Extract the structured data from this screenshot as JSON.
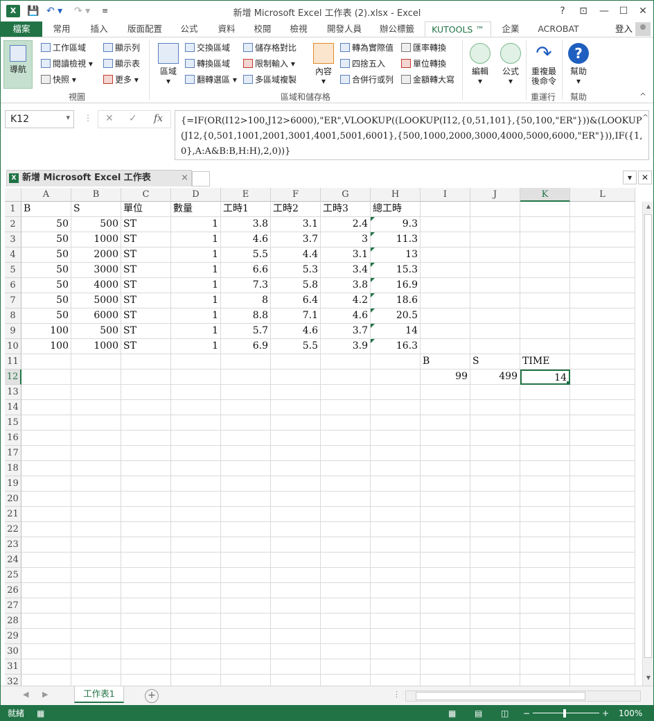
{
  "titlebar": {
    "title": "新增 Microsoft Excel 工作表 (2).xlsx - Excel",
    "help": "?",
    "restore": "⊡",
    "minimize": "—",
    "maximize": "☐",
    "close": "✕"
  },
  "tabs": {
    "file": "檔案",
    "home": "常用",
    "insert": "插入",
    "layout": "版面配置",
    "formulas": "公式",
    "data": "資料",
    "review": "校閱",
    "view": "檢視",
    "developer": "開發人員",
    "office": "辦公標籤",
    "kutools": "KUTOOLS ™",
    "enterprise": "企業",
    "acrobat": "ACROBAT",
    "login": "登入"
  },
  "ribbon": {
    "nav": "導航",
    "workarea": "工作區域",
    "readview": "閱讀檢視",
    "snapshot": "快照",
    "showcol": "顯示列",
    "showsheet": "顯示表",
    "more": "更多",
    "view_group": "視圖",
    "range": "區域",
    "swap": "交換區域",
    "transform": "轉換區域",
    "flip": "翻轉選區",
    "compare": "儲存格對比",
    "limit": "限制輸入",
    "multicopy": "多區域複製",
    "content": "內容",
    "toactual": "轉為實際值",
    "round": "四捨五入",
    "merge": "合併行或列",
    "currency": "匯率轉換",
    "unit": "單位轉換",
    "upper": "金額轉大寫",
    "range_group": "區域和儲存格",
    "edit": "編輯",
    "formula": "公式",
    "rerun": "重複最\n後命令",
    "rerun_group": "重運行",
    "help": "幫助",
    "help_group": "幫助"
  },
  "formulabar": {
    "namebox": "K12",
    "fx": "fx",
    "formula": "{=IF(OR(I12>100,J12>6000),\"ER\",VLOOKUP((LOOKUP(I12,{0,51,101},{50,100,\"ER\"}))&(LOOKUP(J12,{0,501,1001,2001,3001,4001,5001,6001},{500,1000,2000,3000,4000,5000,6000,\"ER\"})),IF({1,0},A:A&B:B,H:H),2,0))}"
  },
  "workbook": {
    "tab": "新增 Microsoft Excel 工作表 (2).xlsx *"
  },
  "sheet": {
    "columns": [
      "A",
      "B",
      "C",
      "D",
      "E",
      "F",
      "G",
      "H",
      "I",
      "J",
      "K",
      "L"
    ],
    "rows": [
      "1",
      "2",
      "3",
      "4",
      "5",
      "6",
      "7",
      "8",
      "9",
      "10",
      "11",
      "12",
      "13",
      "14",
      "15",
      "16",
      "17",
      "18",
      "19",
      "20",
      "21",
      "22",
      "23",
      "24",
      "25",
      "26",
      "27",
      "28",
      "29",
      "30",
      "31",
      "32"
    ],
    "header": [
      "B",
      "S",
      "單位",
      "數量",
      "工時1",
      "工時2",
      "工時3",
      "總工時"
    ],
    "data": [
      [
        "50",
        "500",
        "ST",
        "1",
        "3.8",
        "3.1",
        "2.4",
        "9.3"
      ],
      [
        "50",
        "1000",
        "ST",
        "1",
        "4.6",
        "3.7",
        "3",
        "11.3"
      ],
      [
        "50",
        "2000",
        "ST",
        "1",
        "5.5",
        "4.4",
        "3.1",
        "13"
      ],
      [
        "50",
        "3000",
        "ST",
        "1",
        "6.6",
        "5.3",
        "3.4",
        "15.3"
      ],
      [
        "50",
        "4000",
        "ST",
        "1",
        "7.3",
        "5.8",
        "3.8",
        "16.9"
      ],
      [
        "50",
        "5000",
        "ST",
        "1",
        "8",
        "6.4",
        "4.2",
        "18.6"
      ],
      [
        "50",
        "6000",
        "ST",
        "1",
        "8.8",
        "7.1",
        "4.6",
        "20.5"
      ],
      [
        "100",
        "500",
        "ST",
        "1",
        "5.7",
        "4.6",
        "3.7",
        "14"
      ],
      [
        "100",
        "1000",
        "ST",
        "1",
        "6.9",
        "5.5",
        "3.9",
        "16.3"
      ]
    ],
    "lookup_headers": [
      "B",
      "S",
      "TIME"
    ],
    "lookup_values": [
      "99",
      "499",
      "14"
    ],
    "active_cell": "K12",
    "name": "工作表1"
  },
  "status": {
    "ready": "就緒",
    "zoom": "100%"
  },
  "colors": {
    "accent": "#217346"
  }
}
